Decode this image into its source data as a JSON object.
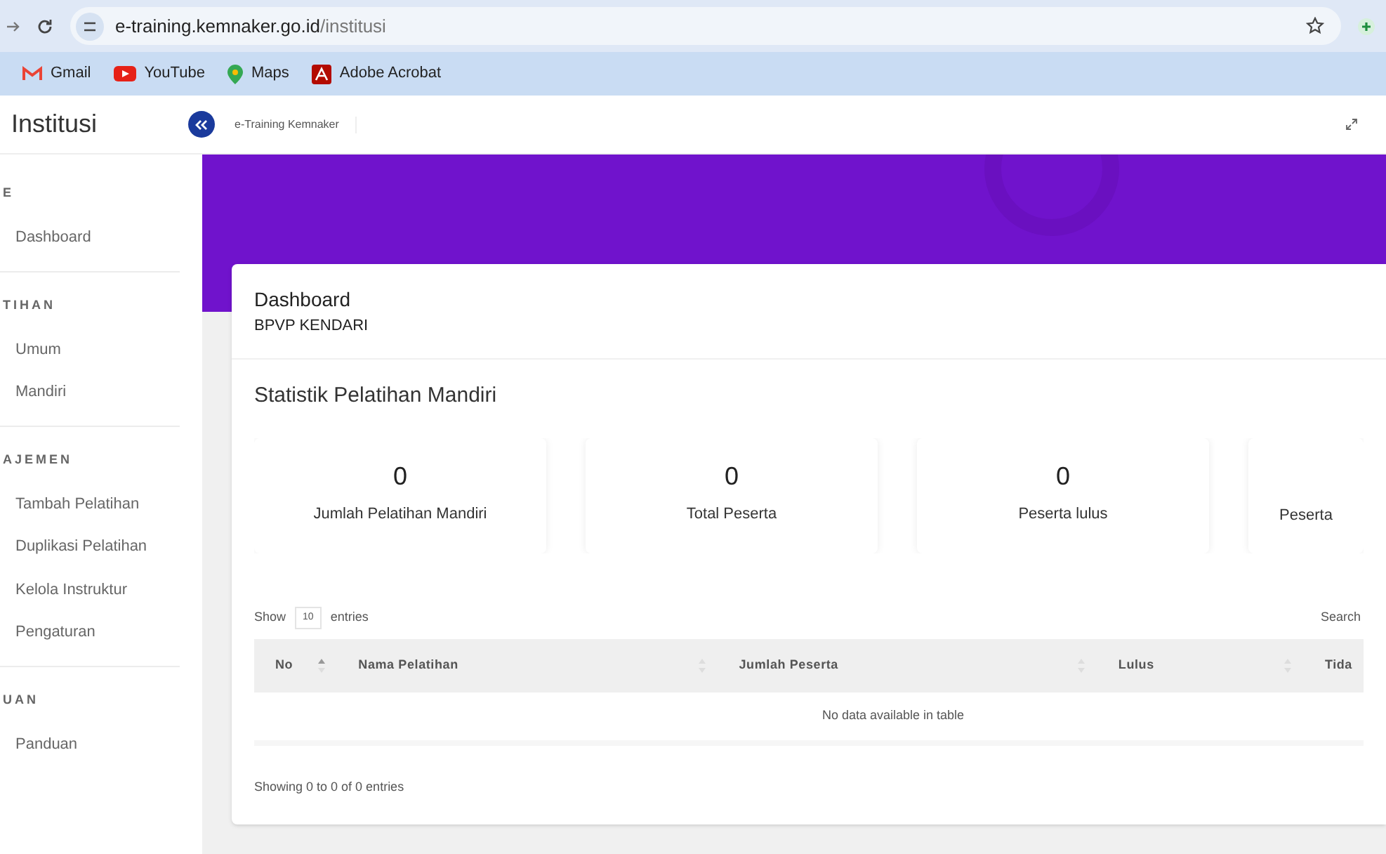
{
  "browser": {
    "url_host": "e-training.kemnaker.go.id",
    "url_path": "/institusi",
    "bookmarks": [
      {
        "kind": "gmail",
        "label": "Gmail"
      },
      {
        "kind": "youtube",
        "label": "YouTube"
      },
      {
        "kind": "maps",
        "label": "Maps"
      },
      {
        "kind": "acrobat",
        "label": "Adobe Acrobat"
      }
    ]
  },
  "header": {
    "title": "Institusi",
    "breadcrumb": "e-Training Kemnaker"
  },
  "sidebar": {
    "sections": [
      {
        "heading": "E",
        "items": [
          {
            "label": "Dashboard",
            "selected": false
          }
        ]
      },
      {
        "heading": "TIHAN",
        "items": [
          {
            "label": "Umum",
            "selected": false
          },
          {
            "label": "Mandiri",
            "selected": false
          }
        ]
      },
      {
        "heading": "AJEMEN",
        "items": [
          {
            "label": "Tambah Pelatihan",
            "selected": false
          },
          {
            "label": "Duplikasi Pelatihan",
            "selected": false
          },
          {
            "label": "Kelola Instruktur",
            "selected": false
          },
          {
            "label": "Pengaturan",
            "selected": false
          }
        ]
      },
      {
        "heading": "UAN",
        "items": [
          {
            "label": "Panduan",
            "selected": false
          }
        ]
      }
    ]
  },
  "page": {
    "title": "Dashboard",
    "subtitle": "BPVP KENDARI"
  },
  "stats": {
    "title": "Statistik Pelatihan Mandiri",
    "cards": [
      {
        "value": "0",
        "label": "Jumlah Pelatihan Mandiri"
      },
      {
        "value": "0",
        "label": "Total Peserta"
      },
      {
        "value": "0",
        "label": "Peserta lulus"
      },
      {
        "label": "Peserta"
      }
    ]
  },
  "table": {
    "show_label": "Show",
    "page_size": "10",
    "entries_label": "entries",
    "search_label": "Search",
    "columns": [
      {
        "label": "No",
        "sorted": true
      },
      {
        "label": "Nama Pelatihan",
        "sorted": false
      },
      {
        "label": "Jumlah Peserta",
        "sorted": false
      },
      {
        "label": "Lulus",
        "sorted": false
      },
      {
        "label": "Tida"
      }
    ],
    "empty_message": "No data available in table",
    "info": "Showing 0 to 0 of 0 entries"
  }
}
